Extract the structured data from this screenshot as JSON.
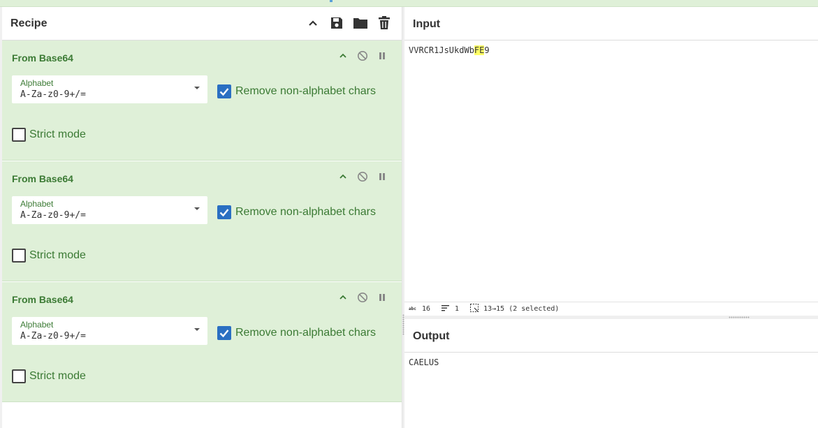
{
  "recipe": {
    "title": "Recipe",
    "header_icons": [
      "chevron-up-icon",
      "save-icon",
      "folder-icon",
      "trash-icon"
    ],
    "operations": [
      {
        "title": "From Base64",
        "alphabet_label": "Alphabet",
        "alphabet_value": "A-Za-z0-9+/=",
        "remove_label": "Remove non-alphabet chars",
        "remove_checked": true,
        "strict_label": "Strict mode",
        "strict_checked": false
      },
      {
        "title": "From Base64",
        "alphabet_label": "Alphabet",
        "alphabet_value": "A-Za-z0-9+/=",
        "remove_label": "Remove non-alphabet chars",
        "remove_checked": true,
        "strict_label": "Strict mode",
        "strict_checked": false
      },
      {
        "title": "From Base64",
        "alphabet_label": "Alphabet",
        "alphabet_value": "A-Za-z0-9+/=",
        "remove_label": "Remove non-alphabet chars",
        "remove_checked": true,
        "strict_label": "Strict mode",
        "strict_checked": false
      }
    ]
  },
  "input": {
    "title": "Input",
    "text_before": "VVRCR1JsUkdWb",
    "text_selected": "FE",
    "text_after": "9"
  },
  "status": {
    "length": "16",
    "lines": "1",
    "selection": "13→15 (2 selected)"
  },
  "output": {
    "title": "Output",
    "text": "CAELUS"
  },
  "colors": {
    "op_background": "#dff0d8",
    "op_title": "#3b7a34",
    "checkbox_checked": "#2a6fc2",
    "selection_highlight": "#ffff66"
  }
}
